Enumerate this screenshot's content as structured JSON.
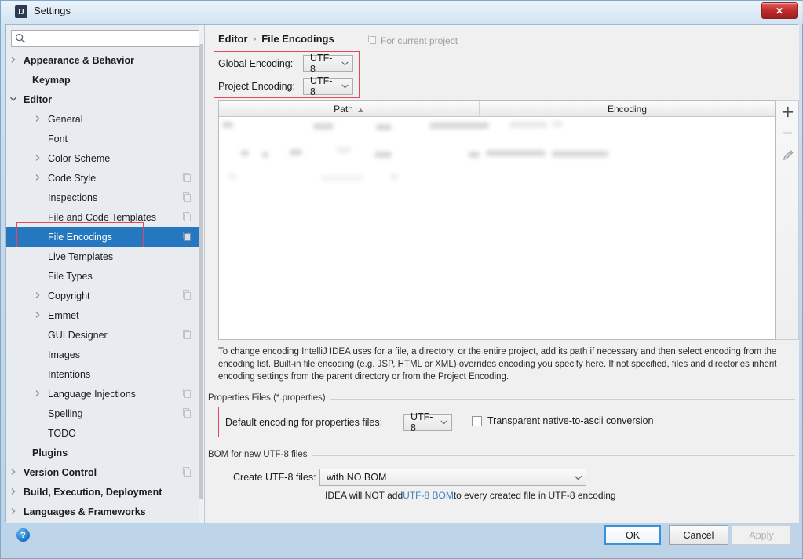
{
  "window": {
    "title": "Settings",
    "app_icon": "IJ",
    "close_label": "✕"
  },
  "sidebar": {
    "search": {
      "placeholder": "",
      "value": "",
      "icon": "search-icon"
    },
    "items": [
      {
        "label": "Appearance & Behavior",
        "indent": 22,
        "bold": true,
        "arrow": "right",
        "copy": false,
        "selected": false
      },
      {
        "label": "Keymap",
        "indent": 33,
        "bold": true,
        "arrow": "",
        "copy": false,
        "selected": false
      },
      {
        "label": "Editor",
        "indent": 22,
        "bold": true,
        "arrow": "down",
        "copy": false,
        "selected": false
      },
      {
        "label": "General",
        "indent": 53,
        "bold": false,
        "arrow": "right",
        "copy": false,
        "selected": false
      },
      {
        "label": "Font",
        "indent": 53,
        "bold": false,
        "arrow": "",
        "copy": false,
        "selected": false
      },
      {
        "label": "Color Scheme",
        "indent": 53,
        "bold": false,
        "arrow": "right",
        "copy": false,
        "selected": false
      },
      {
        "label": "Code Style",
        "indent": 53,
        "bold": false,
        "arrow": "right",
        "copy": true,
        "selected": false
      },
      {
        "label": "Inspections",
        "indent": 53,
        "bold": false,
        "arrow": "",
        "copy": true,
        "selected": false
      },
      {
        "label": "File and Code Templates",
        "indent": 53,
        "bold": false,
        "arrow": "",
        "copy": true,
        "selected": false
      },
      {
        "label": "File Encodings",
        "indent": 53,
        "bold": false,
        "arrow": "",
        "copy": true,
        "selected": true
      },
      {
        "label": "Live Templates",
        "indent": 53,
        "bold": false,
        "arrow": "",
        "copy": false,
        "selected": false
      },
      {
        "label": "File Types",
        "indent": 53,
        "bold": false,
        "arrow": "",
        "copy": false,
        "selected": false
      },
      {
        "label": "Copyright",
        "indent": 53,
        "bold": false,
        "arrow": "right",
        "copy": true,
        "selected": false
      },
      {
        "label": "Emmet",
        "indent": 53,
        "bold": false,
        "arrow": "right",
        "copy": false,
        "selected": false
      },
      {
        "label": "GUI Designer",
        "indent": 53,
        "bold": false,
        "arrow": "",
        "copy": true,
        "selected": false
      },
      {
        "label": "Images",
        "indent": 53,
        "bold": false,
        "arrow": "",
        "copy": false,
        "selected": false
      },
      {
        "label": "Intentions",
        "indent": 53,
        "bold": false,
        "arrow": "",
        "copy": false,
        "selected": false
      },
      {
        "label": "Language Injections",
        "indent": 53,
        "bold": false,
        "arrow": "right",
        "copy": true,
        "selected": false
      },
      {
        "label": "Spelling",
        "indent": 53,
        "bold": false,
        "arrow": "",
        "copy": true,
        "selected": false
      },
      {
        "label": "TODO",
        "indent": 53,
        "bold": false,
        "arrow": "",
        "copy": false,
        "selected": false
      },
      {
        "label": "Plugins",
        "indent": 33,
        "bold": true,
        "arrow": "",
        "copy": false,
        "selected": false
      },
      {
        "label": "Version Control",
        "indent": 22,
        "bold": true,
        "arrow": "right",
        "copy": true,
        "selected": false
      },
      {
        "label": "Build, Execution, Deployment",
        "indent": 22,
        "bold": true,
        "arrow": "right",
        "copy": false,
        "selected": false
      },
      {
        "label": "Languages & Frameworks",
        "indent": 22,
        "bold": true,
        "arrow": "right",
        "copy": false,
        "selected": false
      }
    ]
  },
  "main": {
    "breadcrumb": {
      "root": "Editor",
      "separator": "›",
      "leaf": "File Encodings"
    },
    "for_current_project": {
      "label": "For current project",
      "icon": "copy-icon"
    },
    "global_encoding": {
      "label": "Global Encoding:",
      "value": "UTF-8"
    },
    "project_encoding": {
      "label": "Project Encoding:",
      "value": "UTF-8"
    },
    "table": {
      "columns": [
        "Path",
        "Encoding"
      ],
      "sort_column": "Path",
      "sort_direction": "asc",
      "rows": [],
      "toolbar": {
        "add": "+",
        "remove": "−",
        "edit": "✎"
      }
    },
    "description": "To change encoding IntelliJ IDEA uses for a file, a directory, or the entire project, add its path if necessary and then select encoding from the encoding list. Built-in file encoding (e.g. JSP, HTML or XML) overrides encoding you specify here. If not specified, files and directories inherit encoding settings from the parent directory or from the Project Encoding.",
    "properties_section": {
      "title": "Properties Files (*.properties)",
      "default_encoding_label": "Default encoding for properties files:",
      "default_encoding_value": "UTF-8",
      "transparent_label": "Transparent native-to-ascii conversion",
      "transparent_checked": false
    },
    "bom_section": {
      "title": "BOM for new UTF-8 files",
      "create_label": "Create UTF-8 files:",
      "create_value": "with NO BOM",
      "note_prefix": "IDEA will NOT add ",
      "note_link": "UTF-8 BOM",
      "note_suffix": " to every created file in UTF-8 encoding"
    }
  },
  "footer": {
    "help": "?",
    "ok": "OK",
    "cancel": "Cancel",
    "apply": "Apply"
  },
  "colors": {
    "selection_blue": "#2577bf",
    "annotation_red": "#e8445a",
    "link_blue": "#3f7fbf",
    "default_button_border": "#3a91d8"
  }
}
